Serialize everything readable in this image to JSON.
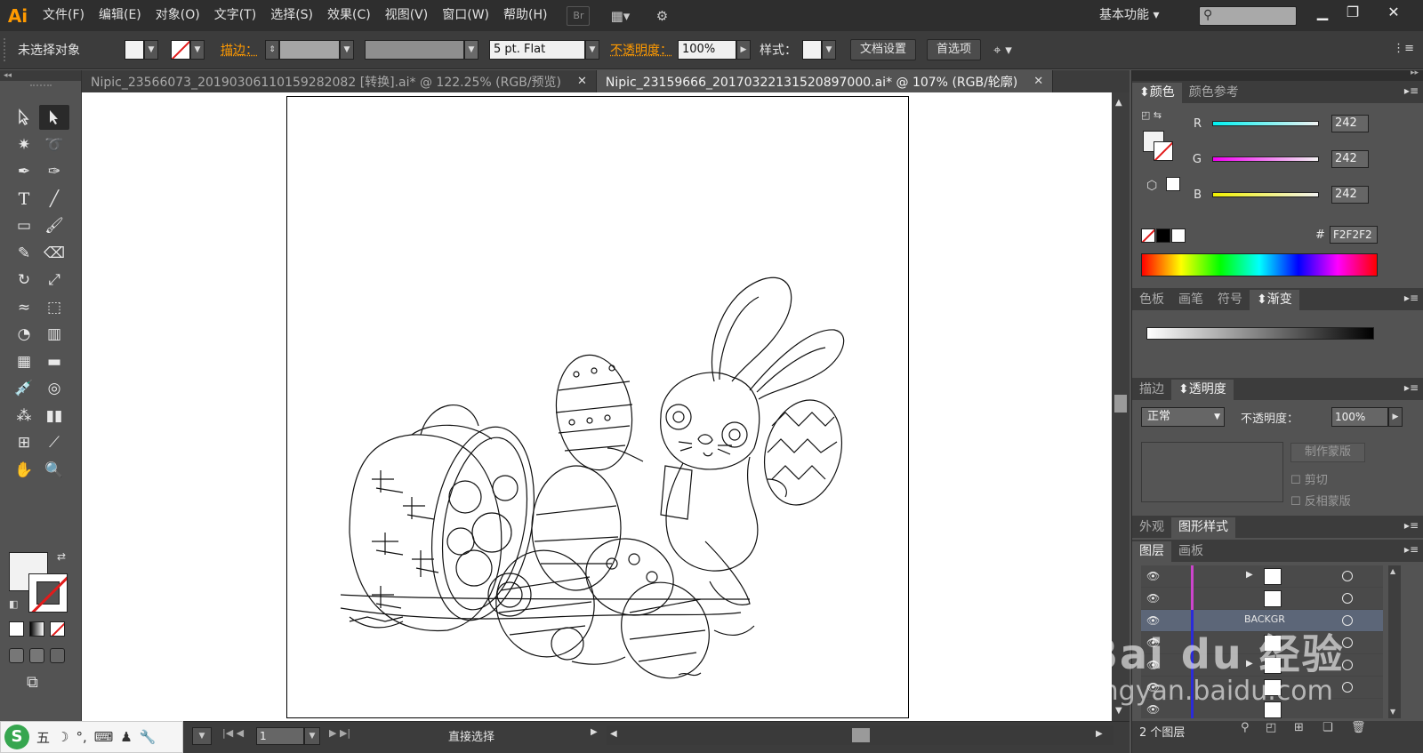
{
  "app": {
    "logo": "Ai",
    "title": "Adobe Illustrator"
  },
  "menu": [
    "文件(F)",
    "编辑(E)",
    "对象(O)",
    "文字(T)",
    "选择(S)",
    "效果(C)",
    "视图(V)",
    "窗口(W)",
    "帮助(H)"
  ],
  "menubar": {
    "bridge_label": "Br",
    "workspace": "基本功能",
    "search_icon": "search-icon"
  },
  "control": {
    "no_selection": "未选择对象",
    "stroke_label": "描边：",
    "brush": "5 pt. Flat",
    "opacity_label": "不透明度：",
    "opacity_value": "100%",
    "style_label": "样式：",
    "doc_setup": "文档设置",
    "preferences": "首选项"
  },
  "tabs": [
    {
      "label": "Nipic_23566073_20190306110159282082 [转换].ai* @ 122.25% (RGB/预览)",
      "active": false
    },
    {
      "label": "Nipic_23159666_20170322131520897000.ai* @ 107% (RGB/轮廓)",
      "active": true
    }
  ],
  "color_panel": {
    "tabs": [
      "颜色",
      "颜色参考"
    ],
    "r_label": "R",
    "g_label": "G",
    "b_label": "B",
    "r": "242",
    "g": "242",
    "b": "242",
    "hex_label": "#",
    "hex": "F2F2F2"
  },
  "swatch_panel": {
    "tabs": [
      "色板",
      "画笔",
      "符号",
      "渐变"
    ]
  },
  "transparency_panel": {
    "tabs": [
      "描边",
      "透明度"
    ],
    "blend_mode": "正常",
    "opacity_label": "不透明度：",
    "opacity": "100%",
    "make_mask": "制作蒙版",
    "clip": "剪切",
    "invert_mask": "反相蒙版"
  },
  "appearance_panel": {
    "tabs": [
      "外观",
      "图形样式"
    ]
  },
  "layers_panel": {
    "tabs": [
      "图层",
      "画板"
    ],
    "rows": [
      {
        "name": "",
        "bar_color": "#cc44cc"
      },
      {
        "name": "",
        "bar_color": "#cc44cc"
      },
      {
        "name": "BACKGR",
        "bar_color": "#2b2bd9"
      },
      {
        "name": "",
        "bar_color": "#2b2bd9"
      },
      {
        "name": "",
        "bar_color": "#2b2bd9"
      },
      {
        "name": "",
        "bar_color": "#2b2bd9"
      },
      {
        "name": "",
        "bar_color": "#2b2bd9"
      }
    ],
    "count": "2 个图层"
  },
  "status": {
    "page": "1",
    "tool": "直接选择"
  },
  "ime": {
    "logo": "S",
    "mode": "五"
  },
  "watermark": {
    "big": "Bai du 经验",
    "small": "jingyan.baidu.com"
  },
  "colors": {
    "accent": "#ff9a00",
    "chrome": "#535353",
    "dark": "#3c3c3c"
  }
}
